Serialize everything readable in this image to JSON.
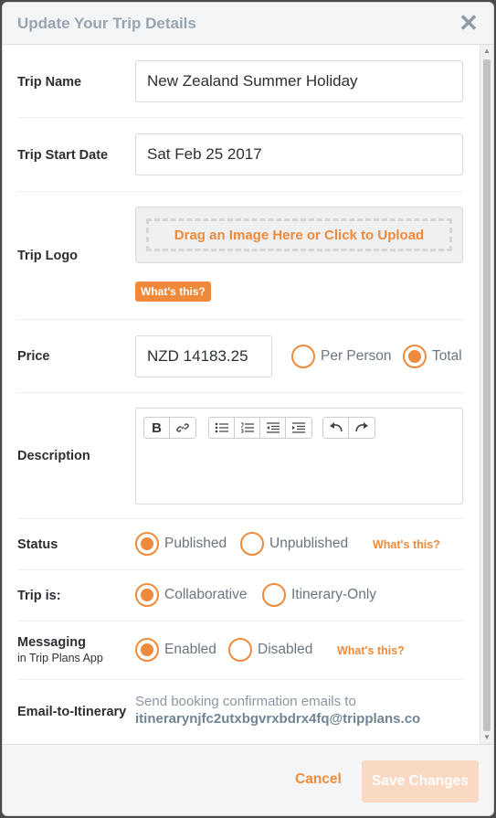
{
  "modal": {
    "title": "Update Your Trip Details",
    "close_icon": "close-icon",
    "close_glyph": "✕"
  },
  "fields": {
    "trip_name": {
      "label": "Trip Name",
      "value": "New Zealand Summer Holiday"
    },
    "trip_start_date": {
      "label": "Trip Start Date",
      "value": "Sat Feb 25 2017"
    },
    "trip_logo": {
      "label": "Trip Logo",
      "upload_text": "Drag an Image Here or Click to Upload",
      "help": "What's this?"
    },
    "price": {
      "label": "Price",
      "value": "NZD 14183.25",
      "options": [
        {
          "label": "Per Person",
          "checked": false
        },
        {
          "label": "Total",
          "checked": true
        }
      ]
    },
    "description": {
      "label": "Description",
      "toolbar": {
        "groups": [
          [
            "bold-icon",
            "link-icon"
          ],
          [
            "bullet-list-icon",
            "numbered-list-icon",
            "outdent-icon",
            "indent-icon"
          ],
          [
            "undo-icon",
            "redo-icon"
          ]
        ]
      },
      "value": ""
    },
    "status": {
      "label": "Status",
      "options": [
        {
          "label": "Published",
          "checked": true
        },
        {
          "label": "Unpublished",
          "checked": false
        }
      ],
      "help": "What's this?"
    },
    "trip_is": {
      "label": "Trip is:",
      "options": [
        {
          "label": "Collaborative",
          "checked": true
        },
        {
          "label": "Itinerary-Only",
          "checked": false
        }
      ]
    },
    "messaging": {
      "label": "Messaging",
      "sublabel": "in Trip Plans App",
      "options": [
        {
          "label": "Enabled",
          "checked": true
        },
        {
          "label": "Disabled",
          "checked": false
        }
      ],
      "help": "What's this?"
    },
    "email_to_itinerary": {
      "label": "Email-to-Itinerary",
      "text": "Send booking confirmation emails to",
      "address": "itinerarynjfc2utxbgvrxbdrx4fq@tripplans.co"
    }
  },
  "footer": {
    "cancel_label": "Cancel",
    "save_label": "Save Changes"
  },
  "colors": {
    "accent": "#ee8a3c",
    "save_disabled": "#f9d9c1",
    "title": "#98a5b1"
  }
}
